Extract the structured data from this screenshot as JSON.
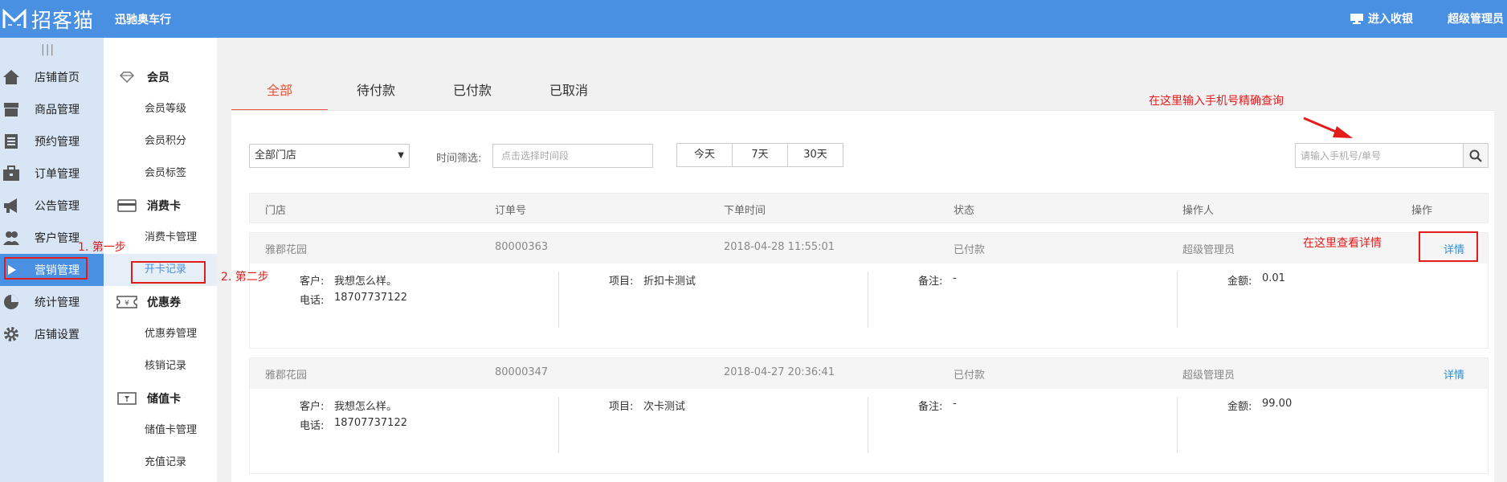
{
  "header": {
    "brand": "招客猫",
    "shop_name": "迅驰奥车行",
    "cashier_label": "进入收银",
    "user_label": "超级管理员"
  },
  "sidebar": {
    "toggle": "|||",
    "items": [
      {
        "label": "店铺首页",
        "icon": "home-icon"
      },
      {
        "label": "商品管理",
        "icon": "store-icon"
      },
      {
        "label": "预约管理",
        "icon": "list-icon"
      },
      {
        "label": "订单管理",
        "icon": "briefcase-icon"
      },
      {
        "label": "公告管理",
        "icon": "megaphone-icon"
      },
      {
        "label": "客户管理",
        "icon": "users-icon"
      },
      {
        "label": "营销管理",
        "icon": "play-icon"
      },
      {
        "label": "统计管理",
        "icon": "pie-icon"
      },
      {
        "label": "店铺设置",
        "icon": "gear-icon"
      }
    ]
  },
  "subnav": {
    "groups": [
      {
        "title": "会员",
        "icon": "diamond-icon",
        "items": [
          "会员等级",
          "会员积分",
          "会员标签"
        ]
      },
      {
        "title": "消费卡",
        "icon": "card-icon",
        "items": [
          "消费卡管理",
          "开卡记录"
        ]
      },
      {
        "title": "优惠券",
        "icon": "ticket-icon",
        "items": [
          "优惠券管理",
          "核销记录"
        ]
      },
      {
        "title": "储值卡",
        "icon": "wallet-icon",
        "items": [
          "储值卡管理",
          "充值记录"
        ]
      }
    ]
  },
  "annotations": {
    "step1": "1. 第一步",
    "step2": "2. 第二步",
    "search_hint": "在这里输入手机号精确查询",
    "detail_hint": "在这里查看详情"
  },
  "tabs": [
    "全部",
    "待付款",
    "已付款",
    "已取消"
  ],
  "filters": {
    "store_select": "全部门店",
    "time_label": "时间筛选:",
    "time_placeholder": "点击选择时间段",
    "quick_ranges": [
      "今天",
      "7天",
      "30天"
    ],
    "search_placeholder": "请输入手机号/单号"
  },
  "table": {
    "columns": [
      "门店",
      "订单号",
      "下单时间",
      "状态",
      "操作人",
      "操作"
    ],
    "rows": [
      {
        "store": "雅郡花园",
        "order_no": "80000363",
        "time": "2018-04-28 11:55:01",
        "status": "已付款",
        "operator": "超级管理员",
        "action": "详情",
        "customer_label": "客户:",
        "customer": "我想怎么样。",
        "phone_label": "电话:",
        "phone": "18707737122",
        "item_label": "项目:",
        "item": "折扣卡测试",
        "note_label": "备注:",
        "note": "-",
        "amount_label": "金额:",
        "amount": "0.01"
      },
      {
        "store": "雅郡花园",
        "order_no": "80000347",
        "time": "2018-04-27 20:36:41",
        "status": "已付款",
        "operator": "超级管理员",
        "action": "详情",
        "customer_label": "客户:",
        "customer": "我想怎么样。",
        "phone_label": "电话:",
        "phone": "18707737122",
        "item_label": "项目:",
        "item": "次卡测试",
        "note_label": "备注:",
        "note": "-",
        "amount_label": "金额:",
        "amount": "99.00"
      }
    ]
  }
}
